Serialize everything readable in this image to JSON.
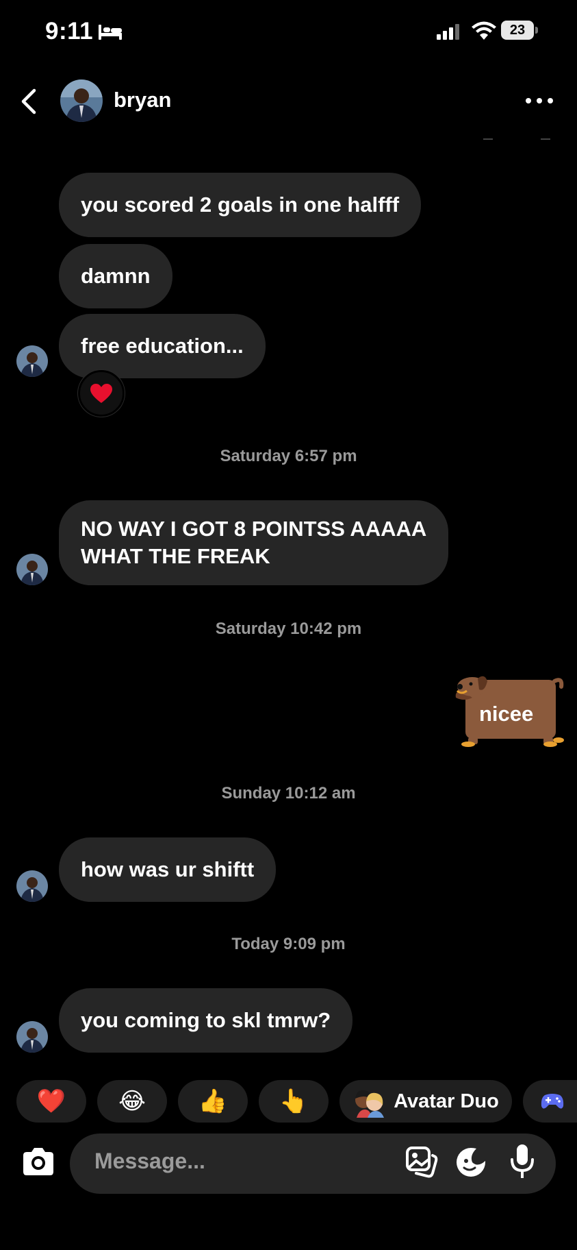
{
  "status_bar": {
    "time": "9:11",
    "battery": "23"
  },
  "header": {
    "contact_name": "bryan"
  },
  "messages": [
    {
      "text": "you scored 2 goals in one halfff"
    },
    {
      "text": "damnn"
    },
    {
      "text": "free education..."
    },
    {
      "lines": [
        "NO WAY I GOT 8 POINTSS AAAAA",
        "WHAT THE FREAK"
      ]
    },
    {
      "text": "how was ur shiftt"
    },
    {
      "text": "you coming to skl tmrw?"
    }
  ],
  "timestamps": [
    "Saturday 6:57 pm",
    "Saturday 10:42 pm",
    "Sunday 10:12 am",
    "Today 9:09 pm"
  ],
  "sent_sticker": {
    "text": "nicee"
  },
  "quick_reactions": [
    "❤️",
    "😂",
    "👍",
    "👆"
  ],
  "avatar_duo": {
    "label": "Avatar Duo"
  },
  "composer": {
    "placeholder": "Message..."
  },
  "colors": {
    "bubble": "#262626",
    "background": "#000000",
    "timestamp": "#9a9a9a",
    "heart": "#e8102e"
  }
}
